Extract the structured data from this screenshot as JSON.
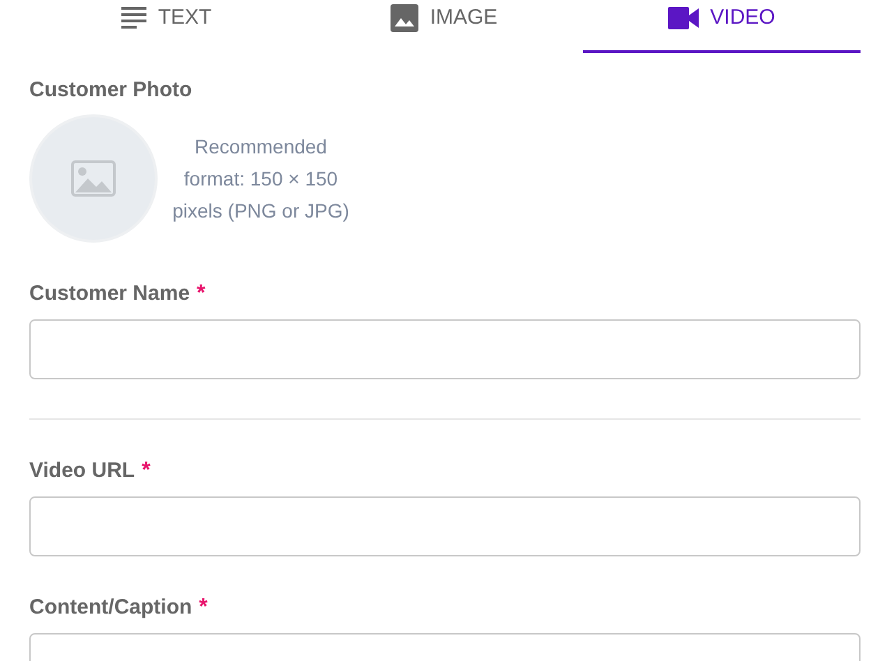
{
  "tabs": [
    {
      "label": "TEXT",
      "selected": false
    },
    {
      "label": "IMAGE",
      "selected": false
    },
    {
      "label": "VIDEO",
      "selected": true
    }
  ],
  "photo": {
    "label": "Customer Photo",
    "hint": "Recommended format: 150 × 150 pixels (PNG or JPG)"
  },
  "sections": [
    {
      "fields": [
        {
          "label": "Customer Name",
          "required_mark": "*"
        }
      ]
    },
    {
      "fields": [
        {
          "label": "Video URL",
          "required_mark": "*"
        },
        {
          "label": "Content/Caption",
          "required_mark": "*"
        }
      ]
    }
  ]
}
